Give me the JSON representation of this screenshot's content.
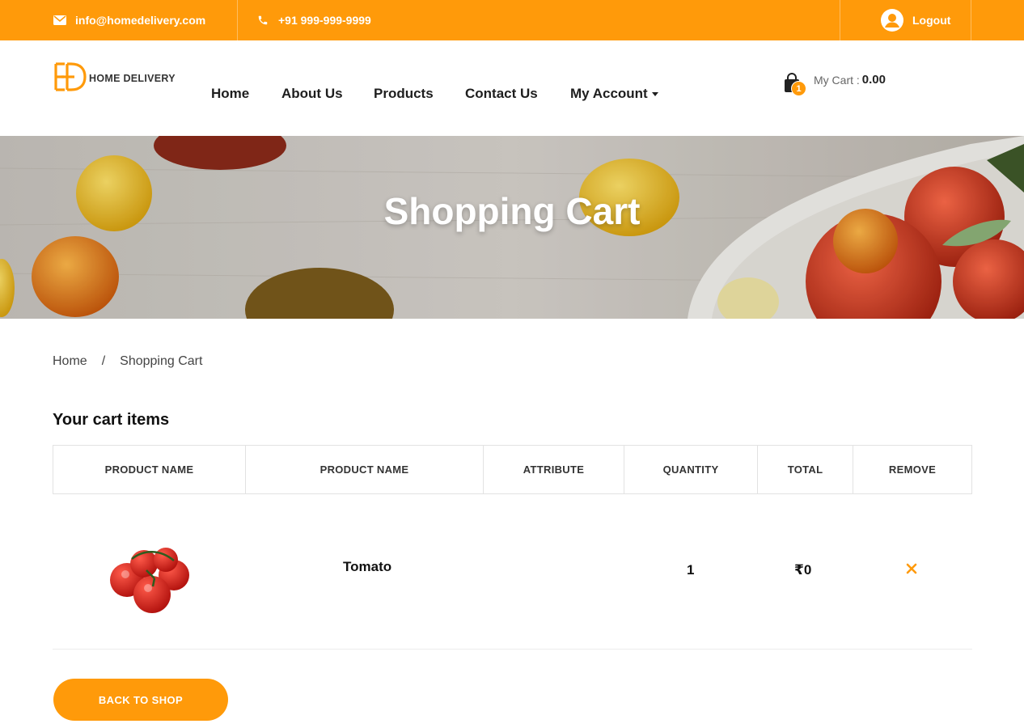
{
  "topbar": {
    "email": "info@homedelivery.com",
    "phone": "+91 999-999-9999",
    "logout_label": "Logout"
  },
  "header": {
    "logo_text": "HOME DELIVERY",
    "nav": [
      "Home",
      "About Us",
      "Products",
      "Contact Us",
      "My Account"
    ],
    "cart_count": "1",
    "cart_label": "My Cart :",
    "cart_value": "0.00"
  },
  "banner": {
    "title": "Shopping Cart"
  },
  "breadcrumb": {
    "home": "Home",
    "separator": "/",
    "current": "Shopping Cart"
  },
  "cart": {
    "title": "Your cart items",
    "columns": [
      "PRODUCT NAME",
      "PRODUCT NAME",
      "ATTRIBUTE",
      "QUANTITY",
      "TOTAL",
      "REMOVE"
    ],
    "rows": [
      {
        "name": "Tomato",
        "attribute": "",
        "quantity": "1",
        "total": "₹0",
        "image": "tomato-image"
      }
    ],
    "remove_icon": "close-icon"
  },
  "actions": {
    "back_label": "BACK TO SHOP"
  },
  "colors": {
    "accent": "#ff9a0a",
    "text": "#1e1e1e"
  }
}
